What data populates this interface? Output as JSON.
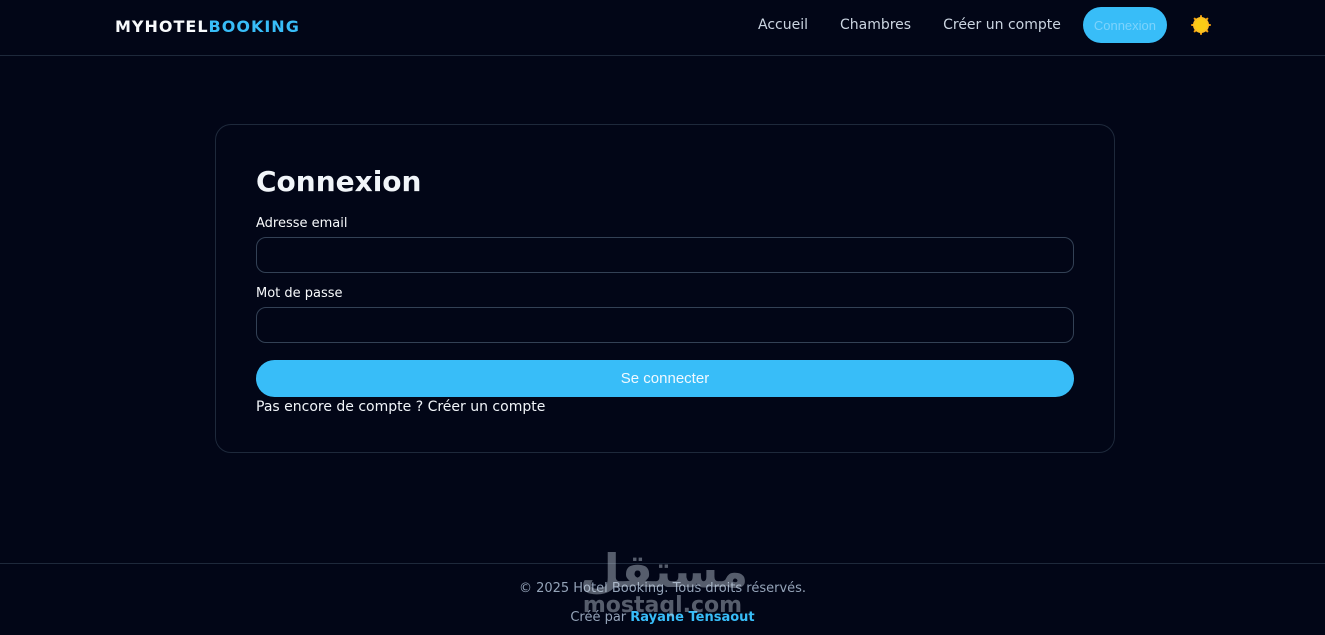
{
  "brand": {
    "part1": "MYHOTEL",
    "part2": "BOOKING"
  },
  "nav": {
    "links": [
      "Accueil",
      "Chambres",
      "Créer un compte"
    ],
    "login_button": "Connexion",
    "theme_icon": "sun-icon"
  },
  "login": {
    "title": "Connexion",
    "email_label": "Adresse email",
    "email_value": "",
    "password_label": "Mot de passe",
    "password_value": "",
    "submit_label": "Se connecter",
    "signup_prompt": "Pas encore de compte ? ",
    "signup_link": "Créer un compte"
  },
  "footer": {
    "copyright": "© 2025 Hotel Booking. Tous droits réservés.",
    "credit_prefix": "Créé par ",
    "credit_author": "Rayane Tensaout"
  },
  "watermark": {
    "arabic": "مستقل",
    "latin": "mostaql.com"
  },
  "colors": {
    "accent": "#38bdf8",
    "background": "#020617",
    "border": "#1e293b"
  }
}
